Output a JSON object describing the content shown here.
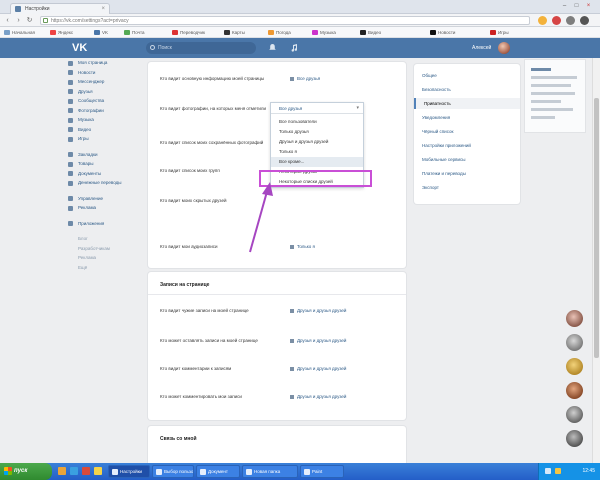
{
  "browser": {
    "tab": {
      "title": "Настройки"
    },
    "url": "https://vk.com/settings?act=privacy",
    "bookmarks": [
      "Начальная",
      "Яндекс",
      "VK",
      "Почта",
      "Переводчик",
      "Карты",
      "Погода",
      "Музыка",
      "Видео",
      "Новости",
      "Игры"
    ]
  },
  "vk": {
    "logo": "VK",
    "search_placeholder": "Поиск",
    "user_name": "Алексей"
  },
  "left_nav": {
    "main": [
      "Моя страница",
      "Новости",
      "Мессенджер",
      "Друзья",
      "Сообщества",
      "Фотографии",
      "Музыка",
      "Видео",
      "Игры"
    ],
    "secondary": [
      "Закладки",
      "Товары",
      "Документы",
      "Денежные переводы"
    ],
    "tertiary": [
      "Управление",
      "Реклама"
    ],
    "extra": [
      "Приложения"
    ],
    "footer": [
      "Блог",
      "Разработчикам",
      "Реклама",
      "Ещё"
    ]
  },
  "privacy": {
    "rows": [
      {
        "label": "Кто видит основную информацию моей страницы",
        "value": "Все друзья"
      },
      {
        "label": "Кто видит фотографии, на которых меня отметили",
        "value": "Все друзья"
      },
      {
        "label": "Кто видит список моих сохранённых фотографий",
        "value": "Все друзья"
      },
      {
        "label": "Кто видит список моих групп",
        "value": "Только друзья"
      },
      {
        "label": "Кто видит моих скрытых друзей",
        "value": "Только я"
      },
      {
        "label": "Кто видит мои аудиозаписи",
        "value": "Только я"
      }
    ],
    "note": "Изменение этой настройки повлияет на отображение в разделе",
    "dropdown": {
      "current": "Все друзья",
      "options": [
        "Все пользователи",
        "Только друзья",
        "Друзья и друзья друзей",
        "Только я",
        "Все кроме...",
        "Некоторые друзья",
        "Некоторые списки друзей"
      ],
      "selected_index": 4
    },
    "section2_title": "Записи на странице",
    "section2_rows": [
      {
        "label": "Кто видит чужие записи на моей странице",
        "value": "Друзья и друзья друзей"
      },
      {
        "label": "Кто может оставлять записи на моей странице",
        "value": "Друзья и друзья друзей"
      },
      {
        "label": "Кто видит комментарии к записям",
        "value": "Друзья и друзья друзей"
      },
      {
        "label": "Кто может комментировать мои записи",
        "value": "Друзья и друзья друзей"
      }
    ],
    "section3_title": "Связь со мной"
  },
  "settings_nav": {
    "items": [
      "Общее",
      "Безопасность",
      "Приватность",
      "Уведомления",
      "Чёрный список",
      "Настройки приложений",
      "Мобильные сервисы",
      "Платежи и переводы",
      "Экспорт"
    ],
    "active_index": 2
  },
  "taskbar": {
    "start": "пуск",
    "tasks": [
      "Настройки",
      "Выбор пользователя",
      "Документ",
      "Новая папка",
      "Paint"
    ],
    "active_index": 0,
    "clock": "12:45"
  },
  "colors": {
    "vk_blue": "#4a76a8",
    "highlight": "#c94fd6",
    "arrow": "#a646c1"
  },
  "icons": {
    "back": "back-arrow-icon",
    "forward": "forward-arrow-icon",
    "reload": "reload-icon"
  }
}
